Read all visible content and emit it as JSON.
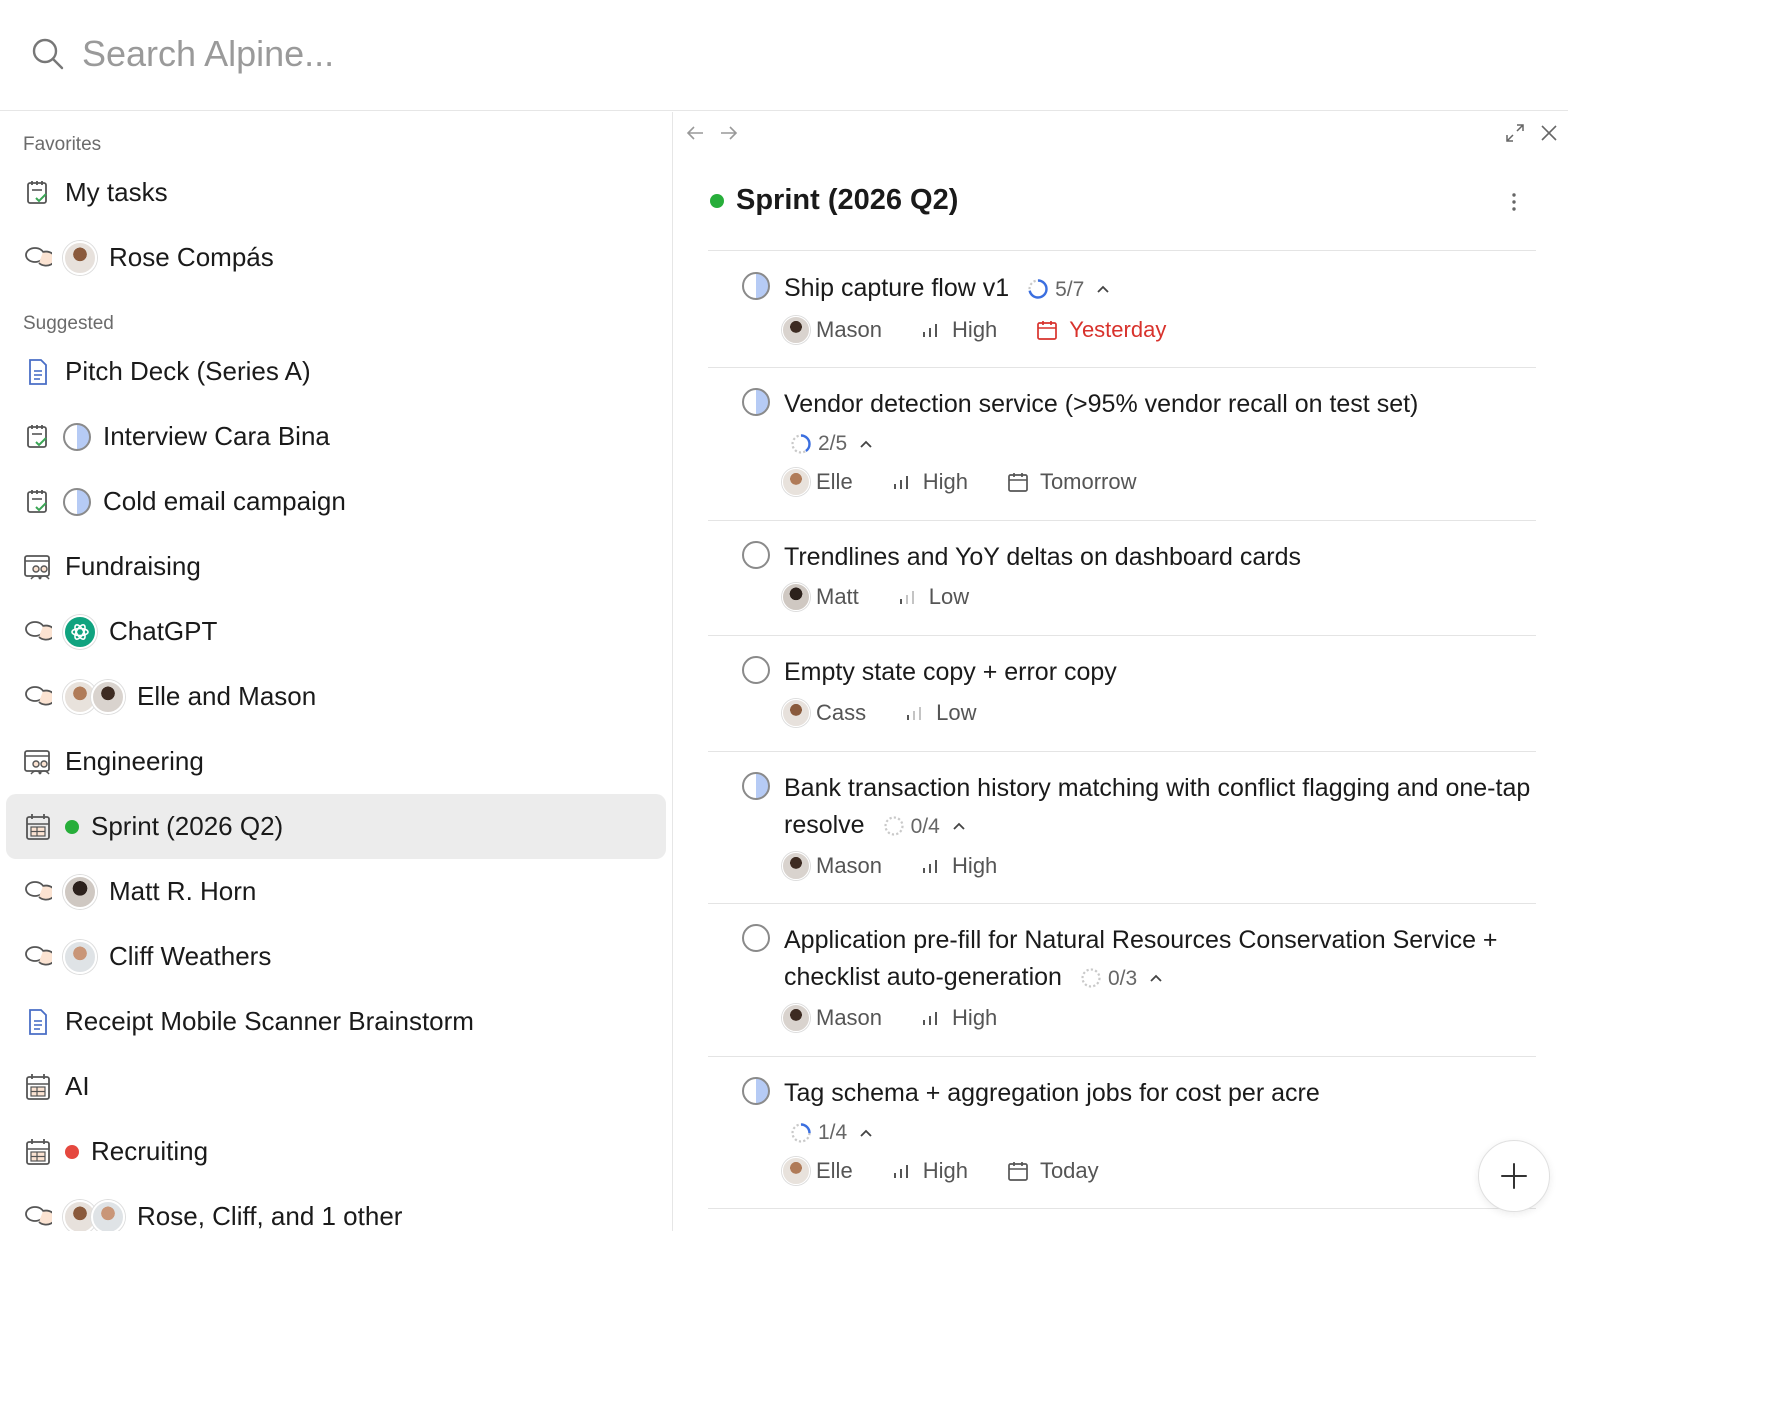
{
  "search": {
    "placeholder": "Search Alpine..."
  },
  "sidebar": {
    "favorites_label": "Favorites",
    "suggested_label": "Suggested",
    "favorites": [
      {
        "label": "My tasks",
        "icon": "task-list-icon"
      },
      {
        "label": "Rose Compás",
        "icon": "chat-bubbles-icon"
      }
    ],
    "suggested": [
      {
        "label": "Pitch Deck (Series A)",
        "icon": "document-icon"
      },
      {
        "label": "Interview Cara Bina",
        "icon": "task-list-icon"
      },
      {
        "label": "Cold email campaign",
        "icon": "task-list-icon"
      },
      {
        "label": "Fundraising",
        "icon": "team-board-icon"
      },
      {
        "label": "ChatGPT",
        "icon": "chat-bubbles-icon"
      },
      {
        "label": "Elle and Mason",
        "icon": "chat-bubbles-icon"
      },
      {
        "label": "Engineering",
        "icon": "team-board-icon"
      },
      {
        "label": "Sprint (2026 Q2)",
        "icon": "sprint-table-icon",
        "dot_color": "#27ae3a"
      },
      {
        "label": "Matt R. Horn",
        "icon": "chat-bubbles-icon"
      },
      {
        "label": "Cliff Weathers",
        "icon": "chat-bubbles-icon"
      },
      {
        "label": "Receipt Mobile Scanner Brainstorm",
        "icon": "document-icon"
      },
      {
        "label": "AI",
        "icon": "sprint-table-icon"
      },
      {
        "label": "Recruiting",
        "icon": "sprint-table-icon",
        "dot_color": "#e5483f"
      },
      {
        "label": "Rose, Cliff, and 1 other",
        "icon": "chat-bubbles-icon"
      }
    ]
  },
  "panel": {
    "title": "Sprint (2026 Q2)",
    "status_color": "#27ae3a",
    "tasks": [
      {
        "title": "Ship capture flow v1",
        "status": "in-progress",
        "subtasks": "5/7",
        "progress": 0.714,
        "assignee": "Mason",
        "priority": "High",
        "due": "Yesterday",
        "due_overdue": true
      },
      {
        "title": "Vendor detection service (>95% vendor recall on test set)",
        "status": "in-progress",
        "subtasks": "2/5",
        "progress": 0.4,
        "assignee": "Elle",
        "priority": "High",
        "due": "Tomorrow"
      },
      {
        "title": "Trendlines and YoY deltas on dashboard cards",
        "status": "todo",
        "assignee": "Matt",
        "priority": "Low"
      },
      {
        "title": "Empty state copy + error copy",
        "status": "todo",
        "assignee": "Cass",
        "priority": "Low"
      },
      {
        "title": "Bank transaction history matching with conflict flagging and one-tap resolve",
        "status": "in-progress",
        "subtasks": "0/4",
        "progress": 0,
        "assignee": "Mason",
        "priority": "High"
      },
      {
        "title": "Application pre-fill for Natural Resources Conservation Service + checklist auto-generation",
        "status": "todo",
        "subtasks": "0/3",
        "progress": 0,
        "assignee": "Mason",
        "priority": "High"
      },
      {
        "title": "Tag schema + aggregation jobs for cost per acre",
        "status": "in-progress",
        "subtasks": "1/4",
        "progress": 0.25,
        "assignee": "Elle",
        "priority": "High",
        "due": "Today"
      }
    ]
  },
  "colors": {
    "accent": "#3b6fe0",
    "overdue": "#d8322c",
    "active_bg": "#ececec"
  }
}
